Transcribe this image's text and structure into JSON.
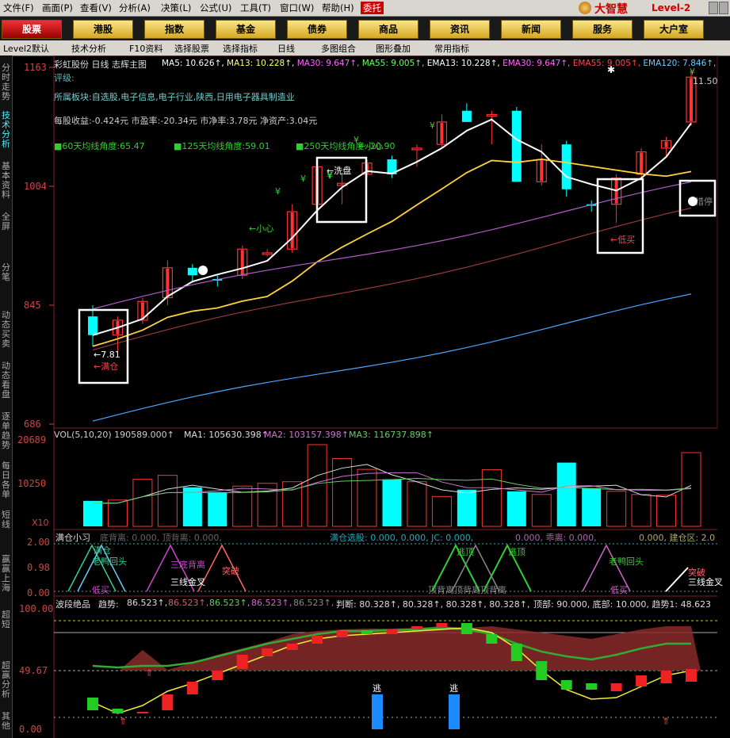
{
  "menu": [
    "文件(F)",
    "画面(P)",
    "查看(V)",
    "分析(A)",
    "决策(L)",
    "公式(U)",
    "工具(T)",
    "窗口(W)",
    "帮助(H)",
    "委托"
  ],
  "brand": {
    "name": "大智慧",
    "level": "Level-2"
  },
  "nav": [
    "股票",
    "港股",
    "指数",
    "基金",
    "债券",
    "商品",
    "资讯",
    "新闻",
    "服务",
    "大户室"
  ],
  "toolbar": [
    "Level2默认",
    "技术分析",
    "F10资料",
    "选择股票",
    "选择指标",
    "日线",
    "多图组合",
    "图形叠加",
    "常用指标"
  ],
  "left_tabs": [
    "分时走势",
    "技术分析",
    "基本资料",
    "全屏",
    "分笔",
    "动态买卖",
    "动态看盘",
    "逐单趋势",
    "每日各单",
    "短线",
    "赢赢上海",
    "超短",
    "超赢分析",
    "其他"
  ],
  "main": {
    "title": "彩虹股份 日线 志辉主图",
    "ma": [
      {
        "label": "MA5: 10.626",
        "color": "#ffffff"
      },
      {
        "label": "MA13: 10.228",
        "color": "#ffff66"
      },
      {
        "label": "MA30: 9.647",
        "color": "#ff66ff"
      },
      {
        "label": "MA55: 9.005",
        "color": "#66ff66"
      },
      {
        "label": "EMA13: 10.228",
        "color": "#ffffff"
      },
      {
        "label": "EMA30: 9.647",
        "color": "#ff66ff"
      },
      {
        "label": "EMA55: 9.005",
        "color": "#ff4444"
      },
      {
        "label": "EMA120: 7.846",
        "color": "#66ccff"
      }
    ],
    "rating": "评级:",
    "sector": "所属板块:自选股,电子信息,电子行业,陕西,日用电子器具制造业",
    "eps": "每股收益:-0.424元 市盈率:-20.34元 市净率:3.78元 净资产:3.04元",
    "angles": [
      "■60天均线角度:65.47",
      "■125天均线角度:59.01",
      "■250天均线角度:-20.90"
    ],
    "y_ticks": [
      "1163",
      "1004",
      "845",
      "686"
    ],
    "high_label": "11.50",
    "low_label": "7.81",
    "annotations": {
      "full": "满仓",
      "wash": "洗盘",
      "careful1": "小心",
      "careful2": "小心",
      "lowbuy": "低买",
      "hold": "惜停"
    },
    "y_marks": [
      "¥",
      "¥",
      "¥",
      "¥",
      "¥",
      "¥",
      "¥"
    ]
  },
  "volume": {
    "header": "VOL(5,10,20) 190589.000↑",
    "ma1": "MA1: 105630.398↑",
    "ma2": "MA2: 103157.398↑",
    "ma3": "MA3: 116737.898↑",
    "y_ticks": [
      "20689",
      "10250"
    ],
    "unit": "X10"
  },
  "ind1": {
    "header": "满仓小习",
    "div": "底背离: 0.000, 顶背离: 0.000,",
    "sel": "满仓选股: 0.000, 0.000, JC: 0.000,",
    "pl": "0.000, 乖离: 0.000,",
    "zone": "0.000, 建仓区: 2.0",
    "y_ticks": [
      "2.00",
      "0.98",
      "0.00"
    ],
    "labels": {
      "full": "满仓",
      "old_duck": "老鸭回头",
      "low_buy": "低买",
      "triple": "三底背离",
      "three_gold": "三线金叉",
      "breakout": "突破",
      "escape1": "逃顶",
      "escape2": "逃顶",
      "top_div": "顶背离顶背离顶背离",
      "old_duck2": "老鸭回头",
      "low_buy2": "低买",
      "breakout2": "突破",
      "three_gold2": "三线金叉"
    }
  },
  "ind2": {
    "header": "波段绝品",
    "trend_label": "趋势:",
    "vals": [
      "86.523↑,",
      "86.523↑,",
      "86.523↑,",
      "86.523↑,",
      "86.523↑,"
    ],
    "judge": "判断: 80.328↑, 80.328↑, 80.328↑, 80.328↑,",
    "top": "顶部: 90.000, 底部: 10.000, 趋势1: 48.623",
    "y_ticks": [
      "100.00",
      "49.67",
      "0.00"
    ],
    "escape": [
      "逃",
      "逃"
    ]
  },
  "colors": {
    "up": "#ff3333",
    "down": "#00ffff",
    "ma5": "#ffffff",
    "ma13": "#ffd23c",
    "ma30": "#b05cc8",
    "ma55": "#9a3b3b",
    "ma120": "#4aa6ff"
  },
  "chart_data": {
    "type": "candlestick",
    "title": "彩虹股份 日线",
    "candles": [
      {
        "o": 8.3,
        "h": 8.45,
        "l": 7.9,
        "c": 8.05,
        "up": false
      },
      {
        "o": 8.05,
        "h": 8.3,
        "l": 7.81,
        "c": 8.25,
        "up": true
      },
      {
        "o": 8.25,
        "h": 8.55,
        "l": 8.2,
        "c": 8.5,
        "up": true
      },
      {
        "o": 8.55,
        "h": 9.05,
        "l": 8.45,
        "c": 8.95,
        "up": true
      },
      {
        "o": 8.95,
        "h": 9.0,
        "l": 8.75,
        "c": 8.85,
        "up": false
      },
      {
        "o": 8.8,
        "h": 8.85,
        "l": 8.7,
        "c": 8.78,
        "up": false
      },
      {
        "o": 8.85,
        "h": 9.25,
        "l": 8.8,
        "c": 9.2,
        "up": true
      },
      {
        "o": 9.15,
        "h": 9.2,
        "l": 9.1,
        "c": 9.15,
        "up": true
      },
      {
        "o": 9.2,
        "h": 9.8,
        "l": 9.15,
        "c": 9.7,
        "up": true
      },
      {
        "o": 9.8,
        "h": 10.4,
        "l": 9.75,
        "c": 10.3,
        "up": true
      },
      {
        "o": 10.05,
        "h": 10.2,
        "l": 9.8,
        "c": 10.08,
        "up": true
      },
      {
        "o": 10.2,
        "h": 10.4,
        "l": 10.15,
        "c": 10.35,
        "up": true
      },
      {
        "o": 10.4,
        "h": 10.45,
        "l": 10.15,
        "c": 10.2,
        "up": false
      },
      {
        "o": 10.55,
        "h": 10.6,
        "l": 10.3,
        "c": 10.55,
        "up": true
      },
      {
        "o": 10.6,
        "h": 11.0,
        "l": 10.55,
        "c": 10.9,
        "up": true
      },
      {
        "o": 11.05,
        "h": 11.15,
        "l": 10.9,
        "c": 10.9,
        "up": false
      },
      {
        "o": 11.0,
        "h": 11.05,
        "l": 10.6,
        "c": 11.0,
        "up": true
      },
      {
        "o": 11.05,
        "h": 11.1,
        "l": 10.1,
        "c": 10.1,
        "up": false
      },
      {
        "o": 10.1,
        "h": 10.6,
        "l": 10.05,
        "c": 10.4,
        "up": true
      },
      {
        "o": 10.6,
        "h": 10.65,
        "l": 9.9,
        "c": 10.0,
        "up": false
      },
      {
        "o": 9.8,
        "h": 9.85,
        "l": 9.7,
        "c": 9.8,
        "up": false
      },
      {
        "o": 9.8,
        "h": 10.2,
        "l": 9.55,
        "c": 10.15,
        "up": true
      },
      {
        "o": 10.2,
        "h": 10.55,
        "l": 10.15,
        "c": 10.5,
        "up": true
      },
      {
        "o": 10.55,
        "h": 10.7,
        "l": 10.45,
        "c": 10.65,
        "up": true
      },
      {
        "o": 10.9,
        "h": 11.6,
        "l": 10.85,
        "c": 11.5,
        "up": true
      }
    ],
    "volume": [
      64000,
      66000,
      118000,
      128000,
      98000,
      86000,
      101000,
      108000,
      112000,
      205000,
      170000,
      143000,
      118000,
      112000,
      75000,
      92000,
      142000,
      88000,
      80000,
      160000,
      96000,
      88000,
      80000,
      78000,
      185000
    ],
    "ylim": [
      6.86,
      11.63
    ]
  }
}
